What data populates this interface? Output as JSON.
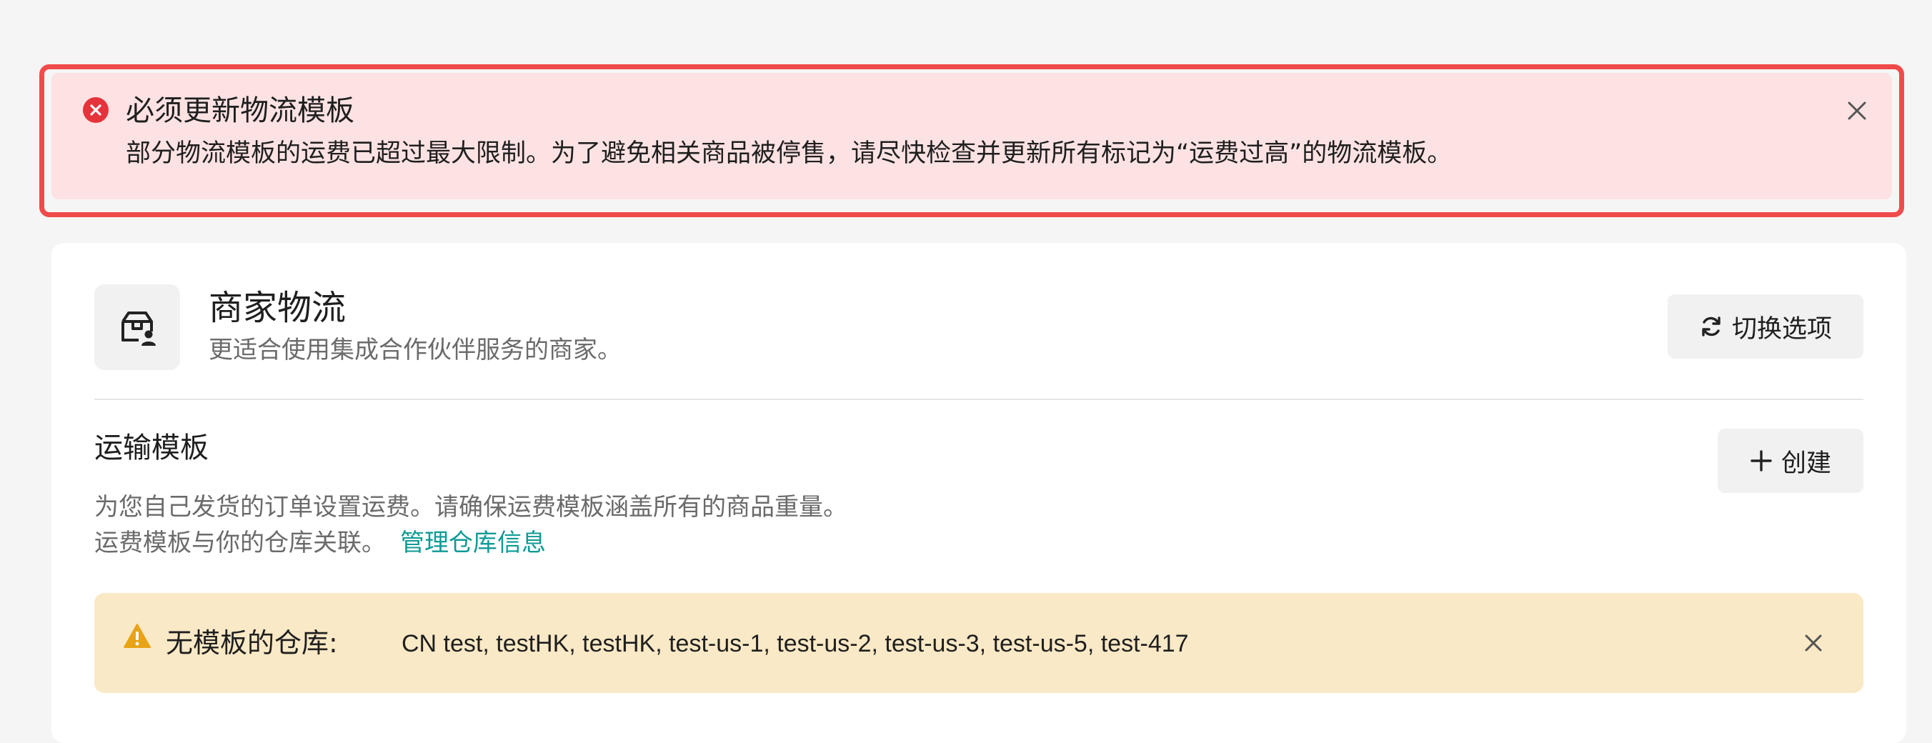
{
  "error_alert": {
    "title": "必须更新物流模板",
    "message": "部分物流模板的运费已超过最大限制。为了避免相关商品被停售，请尽快检查并更新所有标记为“运费过高”的物流模板。",
    "icon": "error-circle-icon",
    "accent_color": "#f04a4a"
  },
  "merchant_logistics": {
    "title": "商家物流",
    "subtitle": "更适合使用集成合作伙伴服务的商家。",
    "switch_button": "切换选项"
  },
  "shipping_template": {
    "title": "运输模板",
    "create_button": "创建",
    "description_line1": "为您自己发货的订单设置运费。请确保运费模板涵盖所有的商品重量。",
    "description_line2": "运费模板与你的仓库关联。",
    "manage_link": "管理仓库信息",
    "link_color": "#0f9a95"
  },
  "warning_banner": {
    "label": "无模板的仓库:",
    "warehouses": "CN test, testHK, testHK, test-us-1, test-us-2, test-us-3, test-us-5, test-417",
    "icon": "warning-triangle-icon",
    "color": "#e8a317"
  }
}
